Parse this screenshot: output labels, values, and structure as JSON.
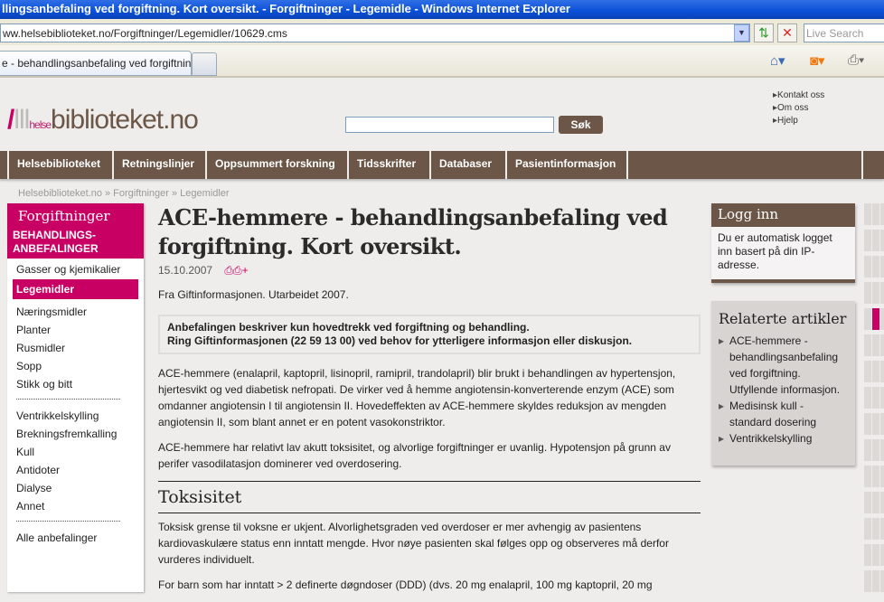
{
  "browser": {
    "title": "llingsanbefaling ved forgiftning. Kort oversikt. - Forgiftninger - Legemidle - Windows Internet Explorer",
    "address": "ww.helsebiblioteket.no/Forgiftninger/Legemidler/10629.cms",
    "live_search_placeholder": "Live Search",
    "tab_label": "e - behandlingsanbefaling ved forgiftning...",
    "icons": [
      "refresh-icon",
      "stop-icon",
      "home-icon",
      "rss-icon",
      "print-icon"
    ]
  },
  "site": {
    "logo": "helsebiblioteket.no",
    "logo_parts": {
      "a": "helse",
      "b": "biblioteket.no"
    },
    "search_button": "Søk",
    "top_links": [
      "Kontakt oss",
      "Om oss",
      "Hjelp"
    ],
    "nav": [
      "Helsebiblioteket",
      "Retningslinjer",
      "Oppsummert forskning",
      "Tidsskrifter",
      "Databaser",
      "Pasientinformasjon"
    ],
    "breadcrumb": "Helsebiblioteket.no » Forgiftninger » Legemidler",
    "accent": "#c80064",
    "brown": "#6b5647"
  },
  "sidebar": {
    "title": "Forgiftninger",
    "subtitle1": "BEHANDLINGS-",
    "subtitle2": "ANBEFALINGER",
    "group1": [
      "Gasser og kjemikalier",
      "Legemidler",
      "Næringsmidler",
      "Planter",
      "Rusmidler",
      "Sopp",
      "Stikk og bitt"
    ],
    "active": "Legemidler",
    "group2": [
      "Ventrikkelskylling",
      "Brekningsfremkalling",
      "Kull",
      "Antidoter",
      "Dialyse",
      "Annet"
    ],
    "all": "Alle anbefalinger"
  },
  "article": {
    "title": "ACE-hemmere - behandlingsanbefaling ved forgiftning. Kort oversikt.",
    "date": "15.10.2007",
    "source": "Fra Giftinformasjonen. Utarbeidet 2007.",
    "notice1": "Anbefalingen beskriver kun hovedtrekk ved forgiftning og behandling.",
    "notice2": "Ring Giftinformasjonen (22 59 13 00) ved behov for ytterligere informasjon eller diskusjon.",
    "para1": "ACE-hemmere (enalapril, kaptopril, lisinopril, ramipril, trandolapril) blir brukt i behandlingen av hypertensjon, hjertesvikt og ved diabetisk nefropati. De virker ved å hemme angiotensin-konverterende enzym (ACE) som omdanner angiotensin I til angiotensin II. Hovedeffekten av ACE-hemmere skyldes reduksjon av mengden angiotensin II, som blant annet er en potent vasokonstriktor.",
    "para2": "ACE-hemmere har relativt lav akutt toksisitet, og alvorlige forgiftninger er uvanlig. Hypotensjon på grunn av perifer vasodilatasjon dominerer ved overdosering.",
    "section_title": "Toksisitet",
    "para3": "Toksisk grense til voksne er ukjent. Alvorlighetsgraden ved overdoser er mer avhengig av pasientens kardiovaskulære status enn inntatt mengde. Hvor nøye pasienten skal følges opp og observeres må derfor vurderes individuelt.",
    "para4": "For barn som har inntatt > 2 definerte døgndoser (DDD) (dvs. 20 mg enalapril, 100 mg kaptopril, 20 mg"
  },
  "login": {
    "title": "Logg inn",
    "text": "Du er automatisk logget inn basert på din IP-adresse."
  },
  "related": {
    "title": "Relaterte artikler",
    "items": [
      "ACE-hemmere - behandlingsanbefaling ved forgiftning. Utfyllende informasjon.",
      "Medisinsk kull - standard dosering",
      "Ventrikkelskylling"
    ]
  }
}
